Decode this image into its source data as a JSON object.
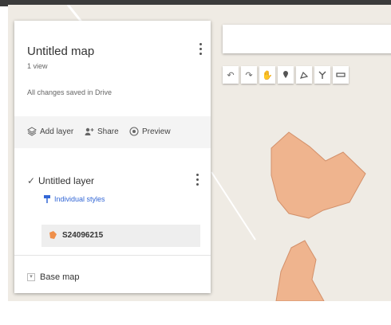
{
  "panel": {
    "title": "Untitled map",
    "views": "1 view",
    "saved_status": "All changes saved in Drive",
    "actions": {
      "add_layer": "Add layer",
      "share": "Share",
      "preview": "Preview"
    },
    "layer": {
      "checked": true,
      "name": "Untitled layer",
      "styles_label": "Individual styles",
      "feature_name": "S24096215"
    },
    "base_map_label": "Base map"
  },
  "toolbar": {
    "tools": [
      "undo-icon",
      "redo-icon",
      "hand-icon",
      "marker-icon",
      "draw-line-icon",
      "route-icon",
      "ruler-icon"
    ]
  },
  "colors": {
    "polygon_fill": "#efb48e",
    "polygon_stroke": "#d3906a",
    "styles_link": "#3367d6",
    "map_bg": "#efebe4"
  }
}
